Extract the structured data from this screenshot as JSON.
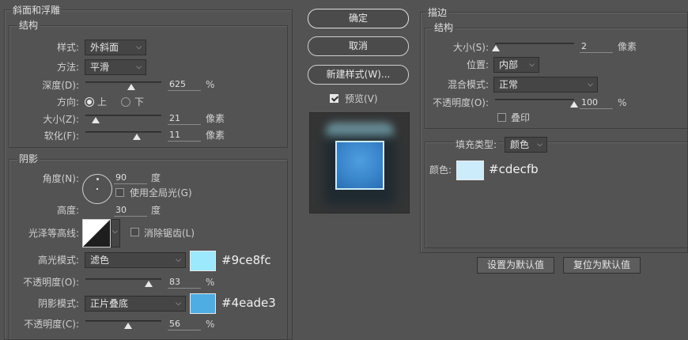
{
  "bevel": {
    "title": "斜面和浮雕",
    "structure_title": "结构",
    "style_label": "样式:",
    "style_value": "外斜面",
    "method_label": "方法:",
    "method_value": "平滑",
    "depth_label": "深度(D):",
    "depth_value": "625",
    "depth_unit": "%",
    "direction_label": "方向:",
    "direction_up": "上",
    "direction_down": "下",
    "size_label": "大小(Z):",
    "size_value": "21",
    "size_unit": "像素",
    "soften_label": "软化(F):",
    "soften_value": "11",
    "soften_unit": "像素",
    "shading_title": "阴影",
    "angle_label": "角度(N):",
    "angle_value": "90",
    "angle_unit": "度",
    "global_light_label": "使用全局光(G)",
    "altitude_label": "高度:",
    "altitude_value": "30",
    "altitude_unit": "度",
    "gloss_label": "光泽等高线:",
    "antialias_label": "消除锯齿(L)",
    "highlight_mode_label": "高光模式:",
    "highlight_mode_value": "滤色",
    "highlight_hex": "#9ce8fc",
    "highlight_opacity_label": "不透明度(O):",
    "highlight_opacity_value": "83",
    "highlight_opacity_unit": "%",
    "shadow_mode_label": "阴影模式:",
    "shadow_mode_value": "正片叠底",
    "shadow_hex": "#4eade3",
    "shadow_opacity_label": "不透明度(C):",
    "shadow_opacity_value": "56",
    "shadow_opacity_unit": "%"
  },
  "buttons": {
    "ok": "确定",
    "cancel": "取消",
    "new_style": "新建样式(W)...",
    "preview": "预览(V)"
  },
  "stroke": {
    "title": "描边",
    "structure_title": "结构",
    "size_label": "大小(S):",
    "size_value": "2",
    "size_unit": "像素",
    "position_label": "位置:",
    "position_value": "内部",
    "blend_label": "混合模式:",
    "blend_value": "正常",
    "opacity_label": "不透明度(O):",
    "opacity_value": "100",
    "opacity_unit": "%",
    "overprint_label": "叠印",
    "fill_type_label": "填充类型:",
    "fill_type_value": "颜色",
    "color_label": "颜色:",
    "color_hex": "#cdecfb",
    "set_default": "设置为默认值",
    "reset_default": "复位为默认值"
  },
  "colors": {
    "highlight": "#9ce8fc",
    "shadow": "#4eade3",
    "stroke": "#cdecfb",
    "preview_fill": "#3a86cc"
  },
  "slider_levels": {
    "depth": 0.6,
    "size": 0.14,
    "soften": 0.68,
    "highlight_opacity": 0.83,
    "shadow_opacity": 0.56,
    "stroke_size": 0.01,
    "stroke_opacity": 1.0
  }
}
